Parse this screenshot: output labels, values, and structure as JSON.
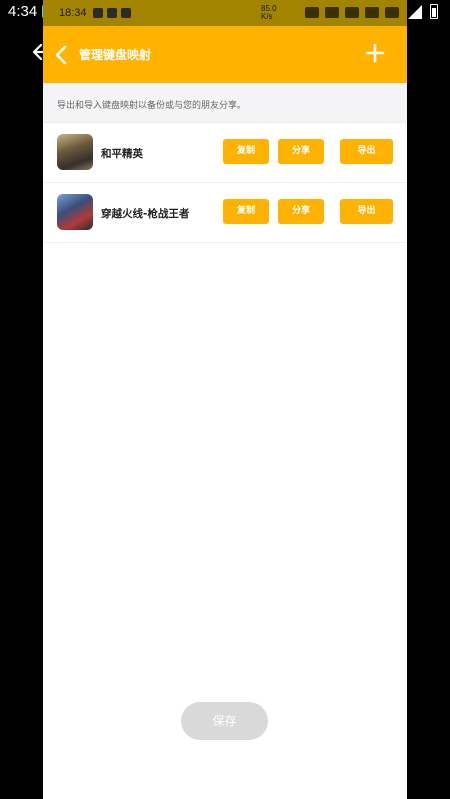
{
  "os_status": {
    "time": "4:34",
    "app_icon": "notification-app-icon",
    "icons": [
      "wifi-icon",
      "signal-icon",
      "battery-icon"
    ]
  },
  "outer_nav": {
    "back_icon": "back-arrow-icon"
  },
  "inner_status": {
    "time": "18:34",
    "network_speed": "85.0",
    "network_unit": "K/s"
  },
  "appbar": {
    "title": "管理键盘映射",
    "back_icon": "chevron-left-icon",
    "add_icon": "plus-icon"
  },
  "hint": "导出和导入键盘映射以备份或与您的朋友分享。",
  "games": [
    {
      "name": "和平精英",
      "copy_label": "复制",
      "share_label": "分享",
      "export_label": "导出"
    },
    {
      "name": "穿越火线-枪战王者",
      "copy_label": "复制",
      "share_label": "分享",
      "export_label": "导出"
    }
  ],
  "save_label": "保存",
  "colors": {
    "accent": "#ffb300",
    "save_disabled": "#d9d9d9"
  }
}
